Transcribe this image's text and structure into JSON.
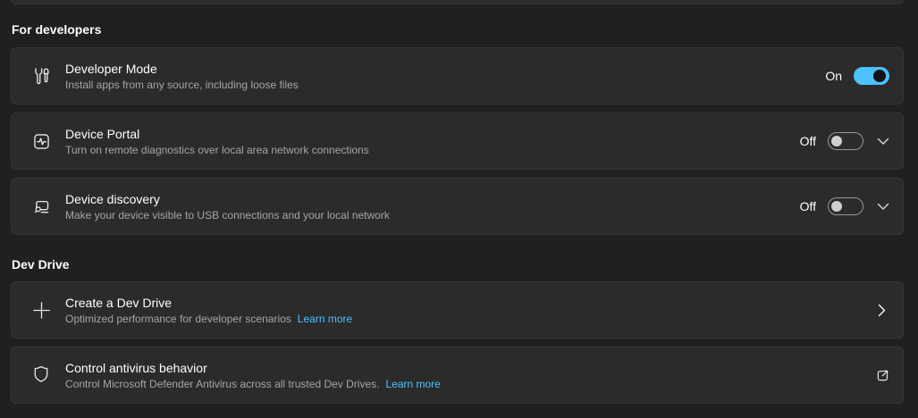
{
  "page": {
    "background_color": "#202020",
    "card_color": "#2b2b2b",
    "accent_color": "#4cc2ff"
  },
  "sections": [
    {
      "heading": "For developers",
      "rows": [
        {
          "icon": "wrench-screwdriver-icon",
          "title": "Developer Mode",
          "subtitle": "Install apps from any source, including loose files",
          "control": {
            "type": "toggle",
            "state": "On"
          }
        },
        {
          "icon": "pulse-monitor-icon",
          "title": "Device Portal",
          "subtitle": "Turn on remote diagnostics over local area network connections",
          "control": {
            "type": "toggle-expander",
            "state": "Off"
          }
        },
        {
          "icon": "device-search-icon",
          "title": "Device discovery",
          "subtitle": "Make your device visible to USB connections and your local network",
          "control": {
            "type": "toggle-expander",
            "state": "Off"
          }
        }
      ]
    },
    {
      "heading": "Dev Drive",
      "rows": [
        {
          "icon": "plus-icon",
          "title": "Create a Dev Drive",
          "subtitle": "Optimized performance for developer scenarios",
          "link_label": "Learn more",
          "control": {
            "type": "navigate"
          }
        },
        {
          "icon": "shield-icon",
          "title": "Control antivirus behavior",
          "subtitle": "Control Microsoft Defender Antivirus across all trusted Dev Drives.",
          "link_label": "Learn more",
          "control": {
            "type": "external-link"
          }
        }
      ]
    }
  ]
}
